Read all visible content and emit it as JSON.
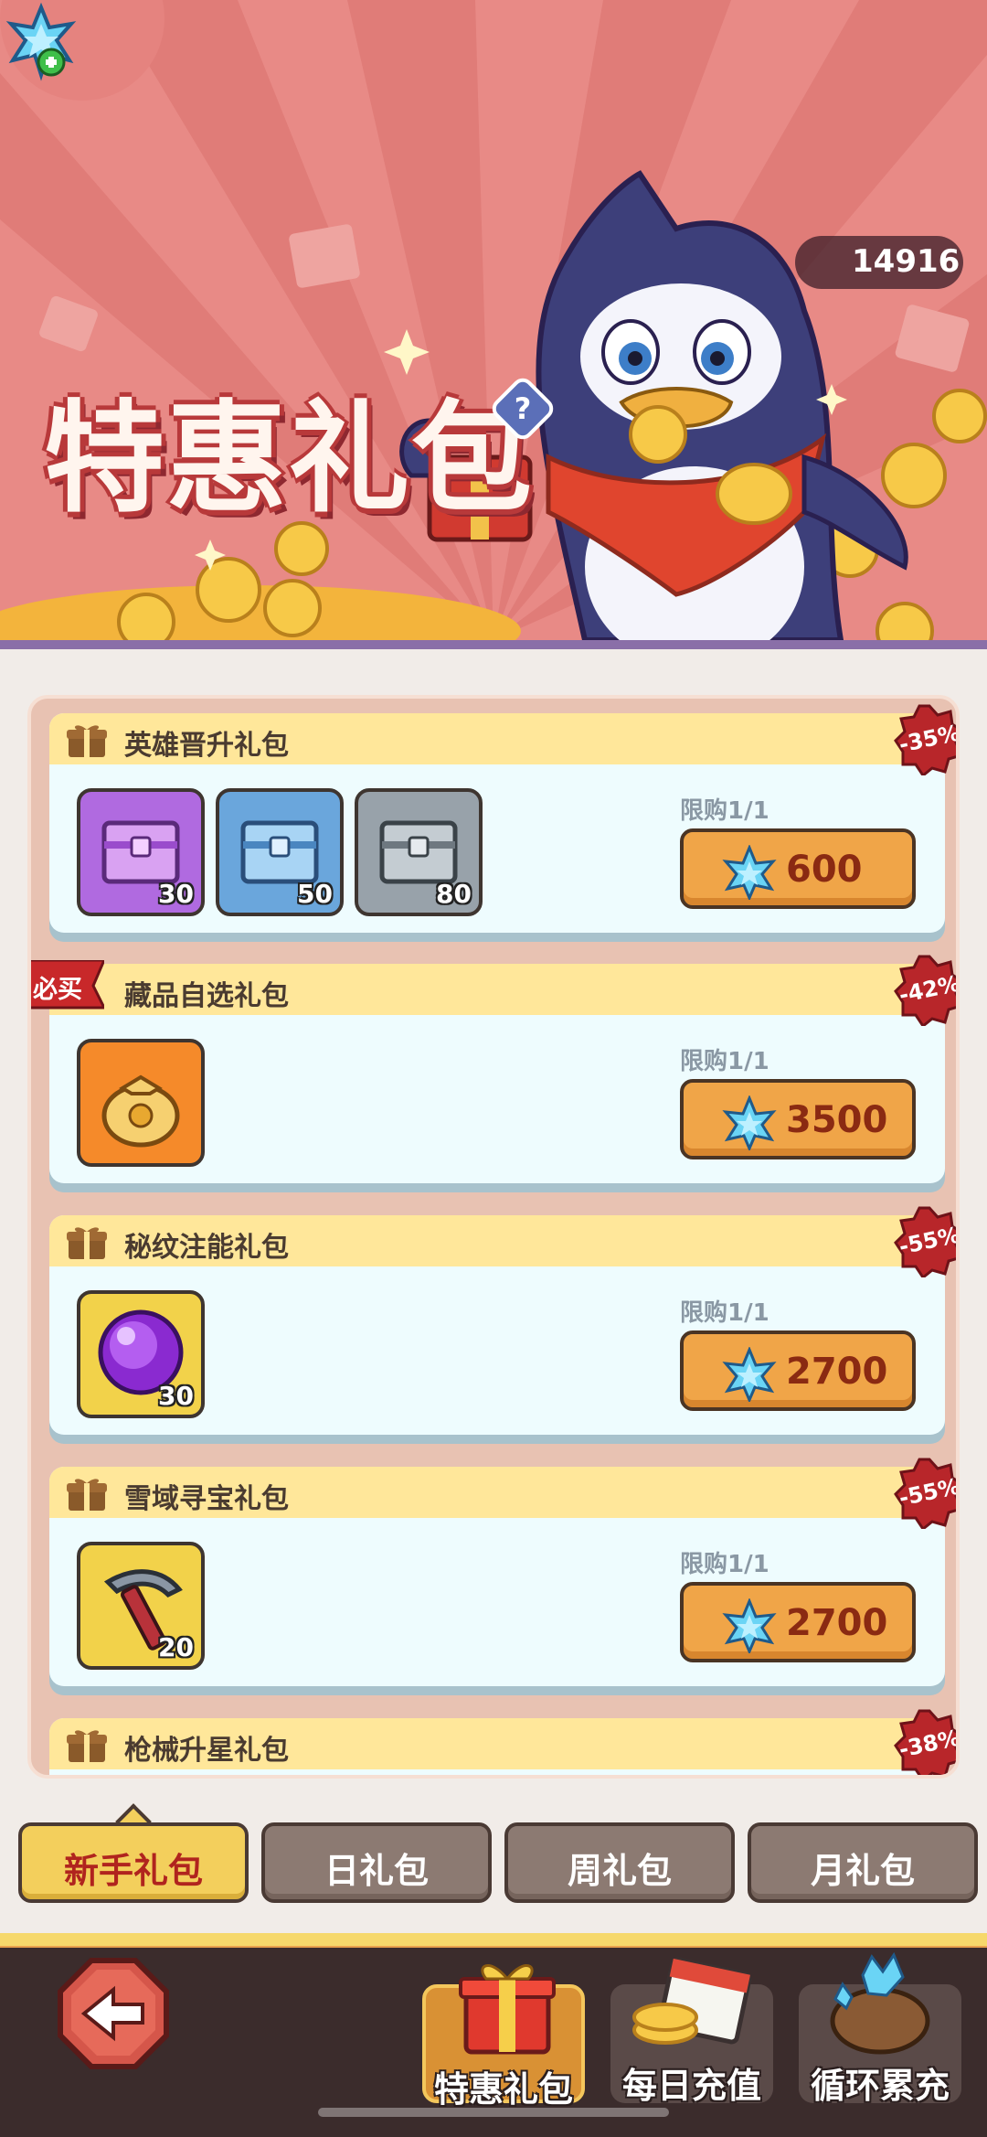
{
  "banner": {
    "title": "特惠礼包",
    "help_symbol": "?",
    "currency_value": "14916",
    "currency_icon": "blue-crystal-plus-icon",
    "mascot": "penguin-mascot"
  },
  "packs": [
    {
      "title": "英雄晋升礼包",
      "discount": "-35%",
      "tag": "",
      "limit": "限购1/1",
      "price": "600",
      "items": [
        {
          "icon": "purple-chest-icon",
          "qty": "30"
        },
        {
          "icon": "blue-chest-icon",
          "qty": "50"
        },
        {
          "icon": "gray-chest-icon",
          "qty": "80"
        }
      ]
    },
    {
      "title": "藏品自选礼包",
      "discount": "-42%",
      "tag": "必买",
      "limit": "限购1/1",
      "price": "3500",
      "items": [
        {
          "icon": "gold-bag-icon",
          "qty": ""
        }
      ]
    },
    {
      "title": "秘纹注能礼包",
      "discount": "-55%",
      "tag": "",
      "limit": "限购1/1",
      "price": "2700",
      "items": [
        {
          "icon": "purple-orb-icon",
          "qty": "30"
        }
      ]
    },
    {
      "title": "雪域寻宝礼包",
      "discount": "-55%",
      "tag": "",
      "limit": "限购1/1",
      "price": "2700",
      "items": [
        {
          "icon": "pickaxe-icon",
          "qty": "20"
        }
      ]
    },
    {
      "title": "枪械升星礼包",
      "discount": "-38%",
      "tag": ""
    }
  ],
  "tabs": [
    {
      "label": "新手礼包",
      "active": true
    },
    {
      "label": "日礼包",
      "active": false
    },
    {
      "label": "周礼包",
      "active": false
    },
    {
      "label": "月礼包",
      "active": false
    }
  ],
  "bottom_nav": [
    {
      "label": "特惠礼包",
      "icon": "gift-box-icon",
      "active": true
    },
    {
      "label": "每日充值",
      "icon": "calendar-coins-icon",
      "active": false
    },
    {
      "label": "循环累充",
      "icon": "crystal-sack-icon",
      "active": false
    }
  ],
  "colors": {
    "banner_bg": "#e88a86",
    "accent_gold": "#f3cf5c",
    "price_button": "#f0a548",
    "discount_badge": "#b8262a"
  }
}
